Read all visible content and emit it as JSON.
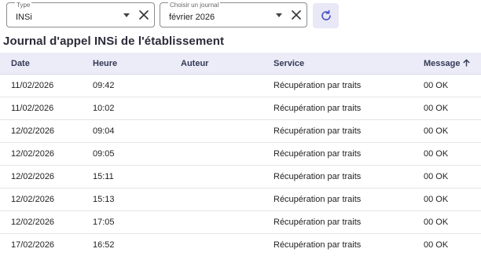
{
  "filters": {
    "type": {
      "label": "Type",
      "value": "INSi"
    },
    "journal": {
      "label": "Choisir un journal",
      "value": "février 2026"
    }
  },
  "title": "Journal d'appel INSi de l'établissement",
  "table": {
    "columns": {
      "date": "Date",
      "heure": "Heure",
      "auteur": "Auteur",
      "service": "Service",
      "message": "Message"
    },
    "sort": {
      "column": "message",
      "direction": "ascending"
    },
    "rows": [
      {
        "date": "11/02/2026",
        "heure": "09:42",
        "auteur": "",
        "service": "Récupération par traits",
        "message": "00 OK"
      },
      {
        "date": "11/02/2026",
        "heure": "10:02",
        "auteur": "",
        "service": "Récupération par traits",
        "message": "00 OK"
      },
      {
        "date": "12/02/2026",
        "heure": "09:04",
        "auteur": "",
        "service": "Récupération par traits",
        "message": "00 OK"
      },
      {
        "date": "12/02/2026",
        "heure": "09:05",
        "auteur": "",
        "service": "Récupération par traits",
        "message": "00 OK"
      },
      {
        "date": "12/02/2026",
        "heure": "15:11",
        "auteur": "",
        "service": "Récupération par traits",
        "message": "00 OK"
      },
      {
        "date": "12/02/2026",
        "heure": "15:13",
        "auteur": "",
        "service": "Récupération par traits",
        "message": "00 OK"
      },
      {
        "date": "12/02/2026",
        "heure": "17:05",
        "auteur": "",
        "service": "Récupération par traits",
        "message": "00 OK"
      },
      {
        "date": "17/02/2026",
        "heure": "16:52",
        "auteur": "",
        "service": "Récupération par traits",
        "message": "00 OK"
      }
    ]
  },
  "icons": {
    "dropdown": "chevron-down-icon",
    "clear": "close-icon",
    "refresh": "refresh-icon",
    "sort": "arrow-up-icon"
  },
  "colors": {
    "header_bg": "#ececf8",
    "refresh_bg": "#e8e8f7",
    "accent": "#4a4fc4"
  }
}
